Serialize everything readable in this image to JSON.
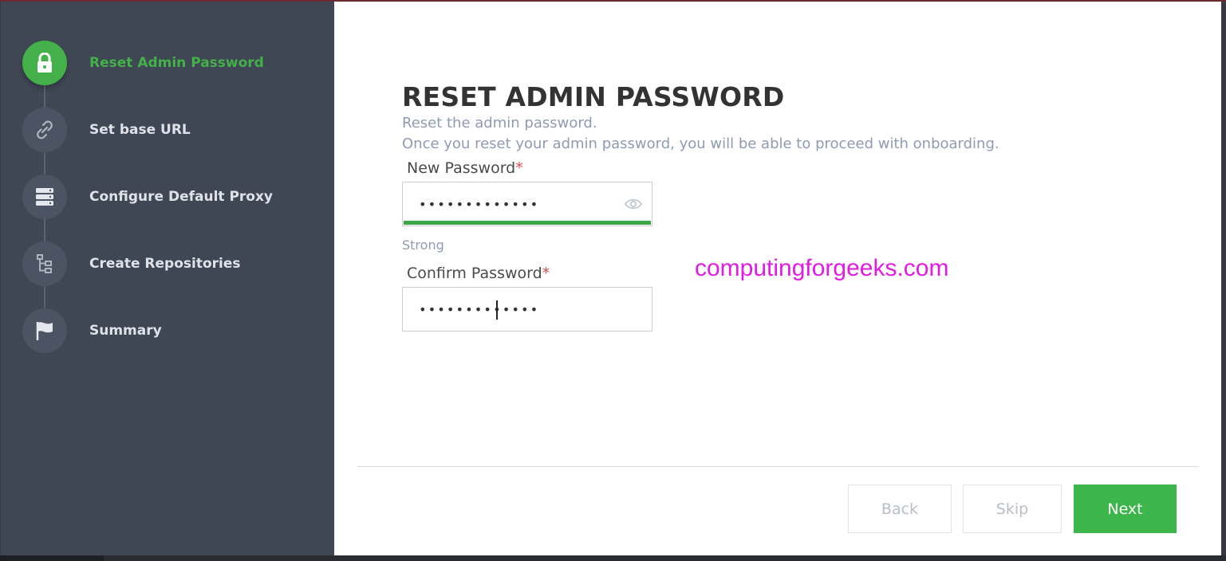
{
  "steps": [
    {
      "label": "Reset Admin Password",
      "icon": "lock-icon",
      "active": true
    },
    {
      "label": "Set base URL",
      "icon": "link-icon",
      "active": false
    },
    {
      "label": "Configure Default Proxy",
      "icon": "server-icon",
      "active": false
    },
    {
      "label": "Create Repositories",
      "icon": "tree-icon",
      "active": false
    },
    {
      "label": "Summary",
      "icon": "flag-icon",
      "active": false
    }
  ],
  "main": {
    "title": "RESET ADMIN PASSWORD",
    "subtitle": "Reset the admin password.",
    "description": "Once you reset your admin password, you will be able to proceed with onboarding.",
    "new_password": {
      "label": "New Password",
      "required_mark": "*",
      "value": "•••••••••••••"
    },
    "strength": "Strong",
    "confirm_password": {
      "label": "Confirm Password",
      "required_mark": "*",
      "value": "•••••••••••••"
    }
  },
  "watermark": "computingforgeeks.com",
  "buttons": {
    "back": "Back",
    "skip": "Skip",
    "next": "Next"
  },
  "colors": {
    "accent": "#43b049",
    "sidebar": "#3f4654",
    "watermark": "#e21be3"
  }
}
